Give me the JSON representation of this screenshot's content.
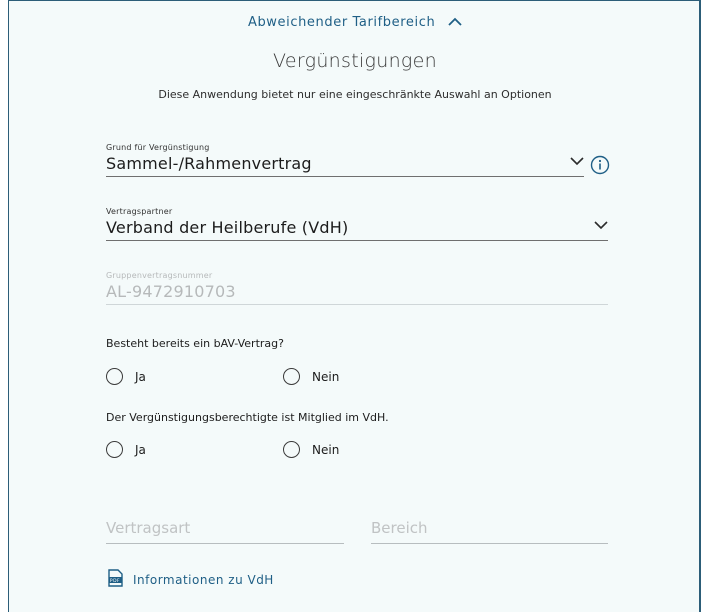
{
  "header": {
    "toggle_label": "Abweichender Tarifbereich",
    "toggle_icon": "chevron-up-icon",
    "title": "Vergünstigungen",
    "subtitle": "Diese Anwendung bietet nur eine eingeschränkte Auswahl an Optionen"
  },
  "fields": {
    "grund": {
      "label": "Grund für Vergünstigung",
      "value": "Sammel-/Rahmenvertrag"
    },
    "partner": {
      "label": "Vertragspartner",
      "value": "Verband der Heilberufe (VdH)"
    },
    "gruppe": {
      "label": "Gruppenvertragsnummer",
      "value": "AL-9472910703"
    }
  },
  "questions": {
    "bav": {
      "text": "Besteht bereits ein bAV-Vertrag?",
      "yes": "Ja",
      "no": "Nein"
    },
    "mitglied": {
      "text": "Der Vergünstigungsberechtigte ist Mitglied im VdH.",
      "yes": "Ja",
      "no": "Nein"
    }
  },
  "bottom": {
    "vertragsart_placeholder": "Vertragsart",
    "bereich_placeholder": "Bereich",
    "pdf_link": "Informationen zu VdH"
  },
  "colors": {
    "accent": "#1f5f86",
    "panel_bg": "#f4fafa",
    "border": "#2c5d78"
  }
}
